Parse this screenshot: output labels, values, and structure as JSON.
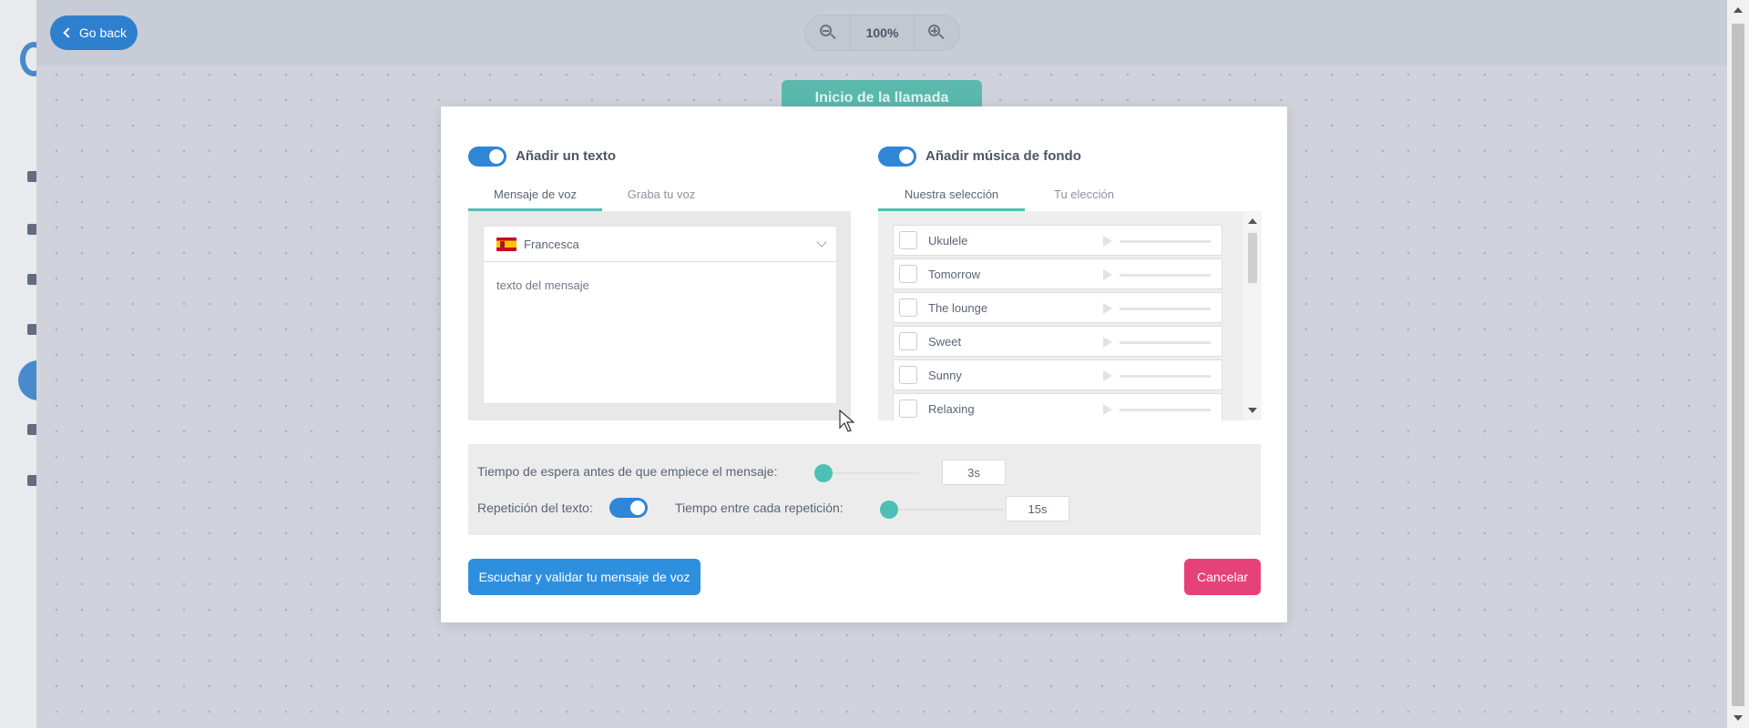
{
  "topbar": {
    "go_back_label": "Go back",
    "zoom_value": "100%"
  },
  "canvas": {
    "start_node_label": "Inicio de la llamada"
  },
  "text_section": {
    "toggle_on": true,
    "title": "Añadir un texto",
    "tabs": [
      {
        "label": "Mensaje de voz",
        "active": true
      },
      {
        "label": "Graba tu voz",
        "active": false
      }
    ],
    "voice": "Francesca",
    "message_text": "texto del mensaje"
  },
  "music_section": {
    "toggle_on": true,
    "title": "Añadir música de fondo",
    "tabs": [
      {
        "label": "Nuestra selección",
        "active": true
      },
      {
        "label": "Tu elección",
        "active": false
      }
    ],
    "tracks": [
      {
        "name": "Ukulele",
        "checked": false
      },
      {
        "name": "Tomorrow",
        "checked": false
      },
      {
        "name": "The lounge",
        "checked": false
      },
      {
        "name": "Sweet",
        "checked": false
      },
      {
        "name": "Sunny",
        "checked": false
      },
      {
        "name": "Relaxing",
        "checked": false
      }
    ]
  },
  "settings": {
    "wait_label": "Tiempo de espera antes de que empiece el mensaje:",
    "wait_value": "3s",
    "repeat_label": "Repetición del texto:",
    "repeat_on": true,
    "interval_label": "Tiempo entre cada repetición:",
    "interval_value": "15s"
  },
  "actions": {
    "listen_validate_label": "Escuchar y validar tu mensaje de voz",
    "cancel_label": "Cancelar"
  },
  "colors": {
    "primary": "#2f8fdf",
    "accent_teal": "#4dc0b5",
    "cancel": "#e54279"
  }
}
